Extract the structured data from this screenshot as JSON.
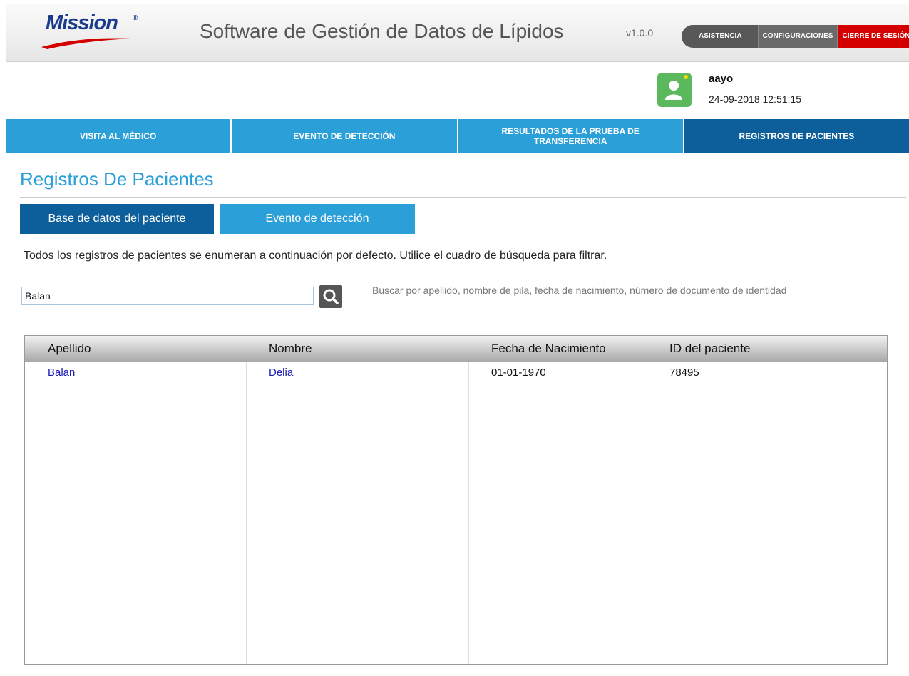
{
  "header": {
    "logo_text": "Mission",
    "logo_reg": "®",
    "title": "Software de Gestión de Datos de Lípidos",
    "version": "v1.0.0",
    "buttons": [
      {
        "label": "ASISTENCIA"
      },
      {
        "label": "CONFIGURACIONES"
      },
      {
        "label": "CIERRE DE SESIÓN"
      }
    ]
  },
  "user": {
    "name": "aayo",
    "datetime": "24-09-2018 12:51:15"
  },
  "nav": [
    {
      "label": "VISITA AL MÉDICO"
    },
    {
      "label": "EVENTO DE DETECCIÓN"
    },
    {
      "label": "RESULTADOS DE LA PRUEBA DE TRANSFERENCIA"
    },
    {
      "label": "REGISTROS DE PACIENTES"
    }
  ],
  "page": {
    "title": "Registros De Pacientes",
    "subtabs": [
      {
        "label": "Base de datos del paciente"
      },
      {
        "label": "Evento de detección"
      }
    ],
    "instructions": "Todos los registros de pacientes se enumeran a continuación por defecto. Utilice el cuadro de búsqueda para filtrar.",
    "search": {
      "value": "Balan",
      "hint": "Buscar por apellido, nombre de pila, fecha de nacimiento, número de documento de identidad"
    }
  },
  "table": {
    "headers": [
      "Apellido",
      "Nombre",
      "Fecha de Nacimiento",
      "ID del paciente"
    ],
    "rows": [
      [
        "Balan",
        "Delia",
        "01-01-1970",
        "78495"
      ]
    ]
  },
  "colors": {
    "nav_blue": "#2b9fd8",
    "nav_active": "#0c5f9b",
    "logout_red": "#d40000",
    "avatar_green": "#5cb85c"
  }
}
